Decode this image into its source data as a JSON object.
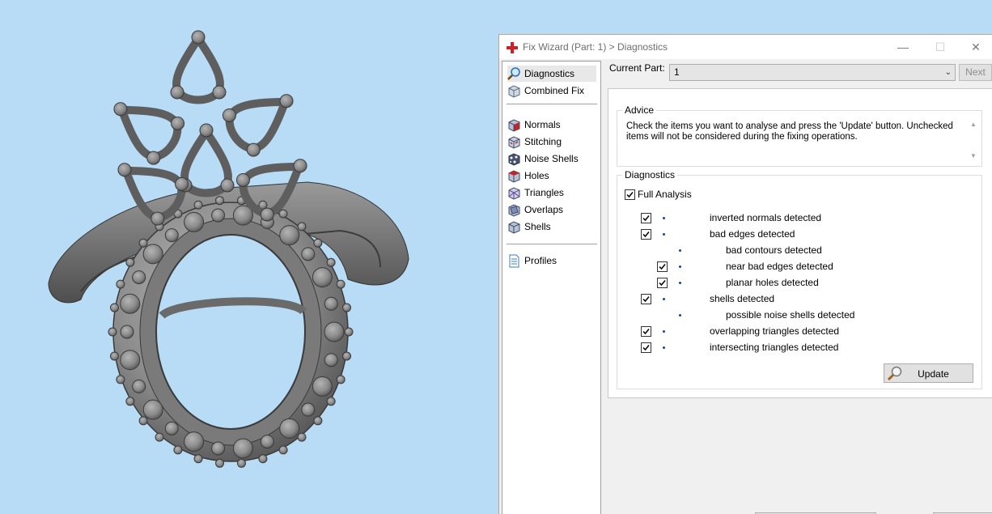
{
  "window": {
    "title": "Fix Wizard (Part: 1) > Diagnostics",
    "controls": {
      "minimize": "—",
      "maximize": "☐",
      "close": "✕"
    }
  },
  "nav": {
    "items": [
      {
        "label": "Diagnostics",
        "icon": "magnifier-icon",
        "selected": true
      },
      {
        "label": "Combined Fix",
        "icon": "cube-icon"
      },
      {
        "label": "Normals",
        "icon": "normals-cube-icon"
      },
      {
        "label": "Stitching",
        "icon": "stitching-cube-icon"
      },
      {
        "label": "Noise Shells",
        "icon": "noise-shells-icon"
      },
      {
        "label": "Holes",
        "icon": "holes-cube-icon"
      },
      {
        "label": "Triangles",
        "icon": "triangles-cube-icon"
      },
      {
        "label": "Overlaps",
        "icon": "overlaps-cube-icon"
      },
      {
        "label": "Shells",
        "icon": "shells-cube-icon"
      },
      {
        "label": "Profiles",
        "icon": "document-icon"
      }
    ]
  },
  "current_part": {
    "label": "Current Part:",
    "value": "1"
  },
  "next_label": "Next",
  "advice": {
    "title": "Advice",
    "text": "Check the items you want to analyse and press the 'Update' button. Unchecked items will not be considered during the fixing operations."
  },
  "diagnostics": {
    "title": "Diagnostics",
    "full_analysis": {
      "label": "Full Analysis",
      "checked": true
    },
    "items": [
      {
        "label": "inverted normals detected",
        "checked": true
      },
      {
        "label": "bad edges detected",
        "checked": true
      },
      {
        "label": "bad contours detected"
      },
      {
        "label": "near bad edges detected",
        "checked": true
      },
      {
        "label": "planar holes detected",
        "checked": true
      },
      {
        "label": "shells detected",
        "checked": true
      },
      {
        "label": "possible noise shells detected"
      },
      {
        "label": "overlapping triangles detected",
        "checked": true
      },
      {
        "label": "intersecting triangles detected",
        "checked": true
      }
    ]
  },
  "update_label": "Update",
  "colors": {
    "viewport_bg": "#b8dcf6",
    "model": "#8c8c8c",
    "title_icon": "#d21f26",
    "bullet": "#1f3fa0"
  }
}
